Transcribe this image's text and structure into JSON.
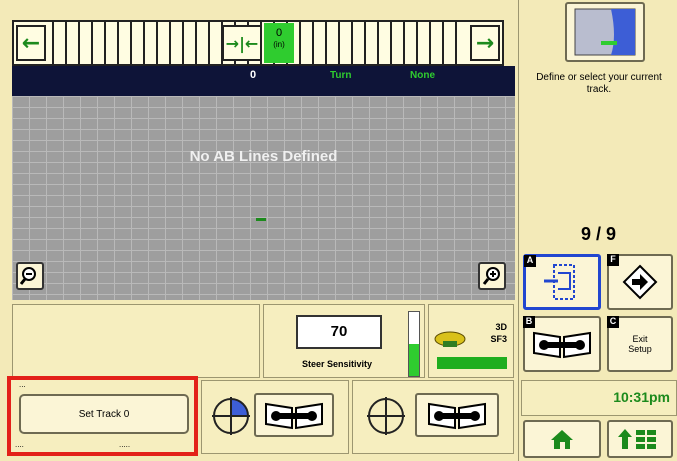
{
  "lightbar": {
    "offset_value": "0",
    "offset_unit": "(in)"
  },
  "status": {
    "offset": "0",
    "turn_label": "Turn",
    "none_label": "None"
  },
  "view": {
    "message": "No AB Lines Defined"
  },
  "steer": {
    "value": "70",
    "label": "Steer Sensitivity",
    "level_fraction": 0.5
  },
  "gps": {
    "mode": "3D",
    "signal": "SF3"
  },
  "track": {
    "set_track_label": "Set Track 0",
    "small_label": "...",
    "bottom_left": "....",
    "bottom_right": "....."
  },
  "right_panel": {
    "define_text": "Define or select your current track.",
    "page_indicator": "9 / 9",
    "tab_a": "A",
    "tab_b": "B",
    "tab_c": "C",
    "tab_f": "F",
    "exit_setup": "Exit Setup",
    "time": "10:31pm"
  },
  "colors": {
    "background": "#f3eab8",
    "status_bar": "#0e1438",
    "accent_green": "#2fcc2f",
    "highlight_blue": "#2146d0",
    "highlight_red": "#e32119"
  }
}
